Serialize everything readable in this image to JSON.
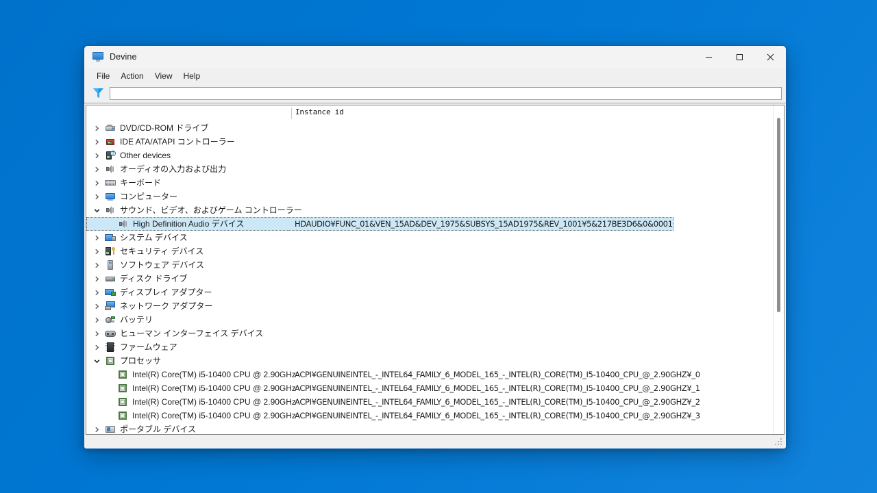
{
  "window": {
    "title": "Devine",
    "title_icon": "monitor-icon",
    "buttons": {
      "minimize": "minimize-icon",
      "maximize": "maximize-icon",
      "close": "close-icon"
    }
  },
  "menubar": {
    "items": [
      {
        "label": "File"
      },
      {
        "label": "Action"
      },
      {
        "label": "View"
      },
      {
        "label": "Help"
      }
    ]
  },
  "toolbar": {
    "filter_icon": "funnel-icon",
    "filter_value": "",
    "filter_placeholder": ""
  },
  "columns": {
    "name_header": "",
    "id_header": "Instance id"
  },
  "tree": {
    "rows": [
      {
        "level": 1,
        "state": "collapsed",
        "icon": "dvd-drive-icon",
        "icon_class": "ico-dvd",
        "label": "DVD/CD-ROM ドライブ",
        "instance_id": ""
      },
      {
        "level": 1,
        "state": "collapsed",
        "icon": "ide-controller-icon",
        "icon_class": "ico-ide",
        "label": "IDE ATA/ATAPI コントローラー",
        "instance_id": ""
      },
      {
        "level": 1,
        "state": "collapsed",
        "icon": "other-device-icon",
        "icon_class": "ico-other",
        "label": "Other devices",
        "instance_id": ""
      },
      {
        "level": 1,
        "state": "collapsed",
        "icon": "audio-io-icon",
        "icon_class": "ico-audio",
        "label": "オーディオの入力および出力",
        "instance_id": ""
      },
      {
        "level": 1,
        "state": "collapsed",
        "icon": "keyboard-icon",
        "icon_class": "ico-keyboard",
        "label": "キーボード",
        "instance_id": ""
      },
      {
        "level": 1,
        "state": "collapsed",
        "icon": "computer-icon",
        "icon_class": "ico-computer",
        "label": "コンピューター",
        "instance_id": ""
      },
      {
        "level": 1,
        "state": "expanded",
        "icon": "sound-controller-icon",
        "icon_class": "ico-audio",
        "label": "サウンド、ビデオ、およびゲーム コントローラー",
        "instance_id": ""
      },
      {
        "level": 2,
        "state": "leaf",
        "selected": true,
        "icon": "audio-device-icon",
        "icon_class": "ico-audio",
        "label": "High Definition Audio デバイス",
        "instance_id": "HDAUDIO¥FUNC_01&VEN_15AD&DEV_1975&SUBSYS_15AD1975&REV_1001¥5&217BE3D6&0&0001"
      },
      {
        "level": 1,
        "state": "collapsed",
        "icon": "system-device-icon",
        "icon_class": "ico-system",
        "label": "システム デバイス",
        "instance_id": ""
      },
      {
        "level": 1,
        "state": "collapsed",
        "icon": "security-device-icon",
        "icon_class": "ico-security",
        "label": "セキュリティ デバイス",
        "instance_id": ""
      },
      {
        "level": 1,
        "state": "collapsed",
        "icon": "software-device-icon",
        "icon_class": "ico-software",
        "label": "ソフトウェア デバイス",
        "instance_id": ""
      },
      {
        "level": 1,
        "state": "collapsed",
        "icon": "disk-drive-icon",
        "icon_class": "ico-disk",
        "label": "ディスク ドライブ",
        "instance_id": ""
      },
      {
        "level": 1,
        "state": "collapsed",
        "icon": "display-adapter-icon",
        "icon_class": "ico-display",
        "label": "ディスプレイ アダプター",
        "instance_id": ""
      },
      {
        "level": 1,
        "state": "collapsed",
        "icon": "network-adapter-icon",
        "icon_class": "ico-network",
        "label": "ネットワーク アダプター",
        "instance_id": ""
      },
      {
        "level": 1,
        "state": "collapsed",
        "icon": "battery-icon",
        "icon_class": "ico-battery",
        "label": "バッテリ",
        "instance_id": ""
      },
      {
        "level": 1,
        "state": "collapsed",
        "icon": "hid-device-icon",
        "icon_class": "ico-hid",
        "label": "ヒューマン インターフェイス デバイス",
        "instance_id": ""
      },
      {
        "level": 1,
        "state": "collapsed",
        "icon": "firmware-icon",
        "icon_class": "ico-firmware",
        "label": "ファームウェア",
        "instance_id": ""
      },
      {
        "level": 1,
        "state": "expanded",
        "icon": "processor-icon",
        "icon_class": "ico-cpu",
        "label": "プロセッサ",
        "instance_id": ""
      },
      {
        "level": 2,
        "state": "leaf",
        "icon": "processor-icon",
        "icon_class": "ico-cpu",
        "label": "Intel(R) Core(TM) i5-10400 CPU @ 2.90GHz",
        "instance_id": "ACPI¥GENUINEINTEL_-_INTEL64_FAMILY_6_MODEL_165_-_INTEL(R)_CORE(TM)_I5-10400_CPU_@_2.90GHZ¥_0"
      },
      {
        "level": 2,
        "state": "leaf",
        "icon": "processor-icon",
        "icon_class": "ico-cpu",
        "label": "Intel(R) Core(TM) i5-10400 CPU @ 2.90GHz",
        "instance_id": "ACPI¥GENUINEINTEL_-_INTEL64_FAMILY_6_MODEL_165_-_INTEL(R)_CORE(TM)_I5-10400_CPU_@_2.90GHZ¥_1"
      },
      {
        "level": 2,
        "state": "leaf",
        "icon": "processor-icon",
        "icon_class": "ico-cpu",
        "label": "Intel(R) Core(TM) i5-10400 CPU @ 2.90GHz",
        "instance_id": "ACPI¥GENUINEINTEL_-_INTEL64_FAMILY_6_MODEL_165_-_INTEL(R)_CORE(TM)_I5-10400_CPU_@_2.90GHZ¥_2"
      },
      {
        "level": 2,
        "state": "leaf",
        "icon": "processor-icon",
        "icon_class": "ico-cpu",
        "label": "Intel(R) Core(TM) i5-10400 CPU @ 2.90GHz",
        "instance_id": "ACPI¥GENUINEINTEL_-_INTEL64_FAMILY_6_MODEL_165_-_INTEL(R)_CORE(TM)_I5-10400_CPU_@_2.90GHZ¥_3"
      },
      {
        "level": 1,
        "state": "collapsed",
        "icon": "portable-device-icon",
        "icon_class": "ico-portable",
        "label": "ポータブル デバイス",
        "instance_id": ""
      }
    ]
  },
  "colors": {
    "desktop": "#0078d4",
    "selection": "#cce8f7",
    "accent": "#1a9bf0"
  }
}
